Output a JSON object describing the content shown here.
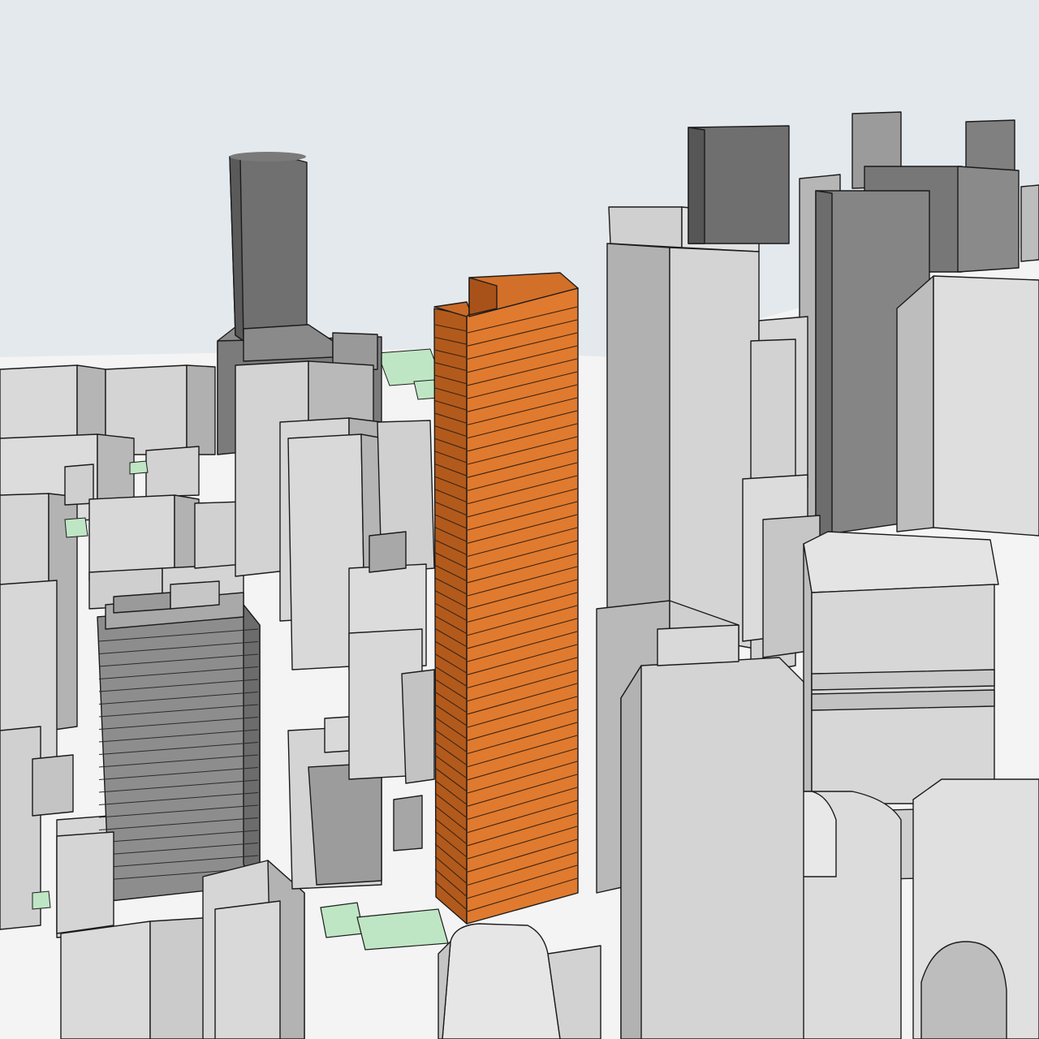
{
  "scene": {
    "kind": "3D massing model view",
    "colors": {
      "sky": "#e4e9ed",
      "ground": "#f6f6f6",
      "building_light": "#d6d6d6",
      "building_light_side": "#b4b4b4",
      "building_dark": "#6e6e6e",
      "building_dark_side": "#555555",
      "proposed_tower_front": "#e07a2e",
      "proposed_tower_side": "#b25a1c",
      "park_green": "#bfe6c4",
      "outline": "#1b1b1b"
    },
    "highlighted_element": "proposed-tower"
  }
}
